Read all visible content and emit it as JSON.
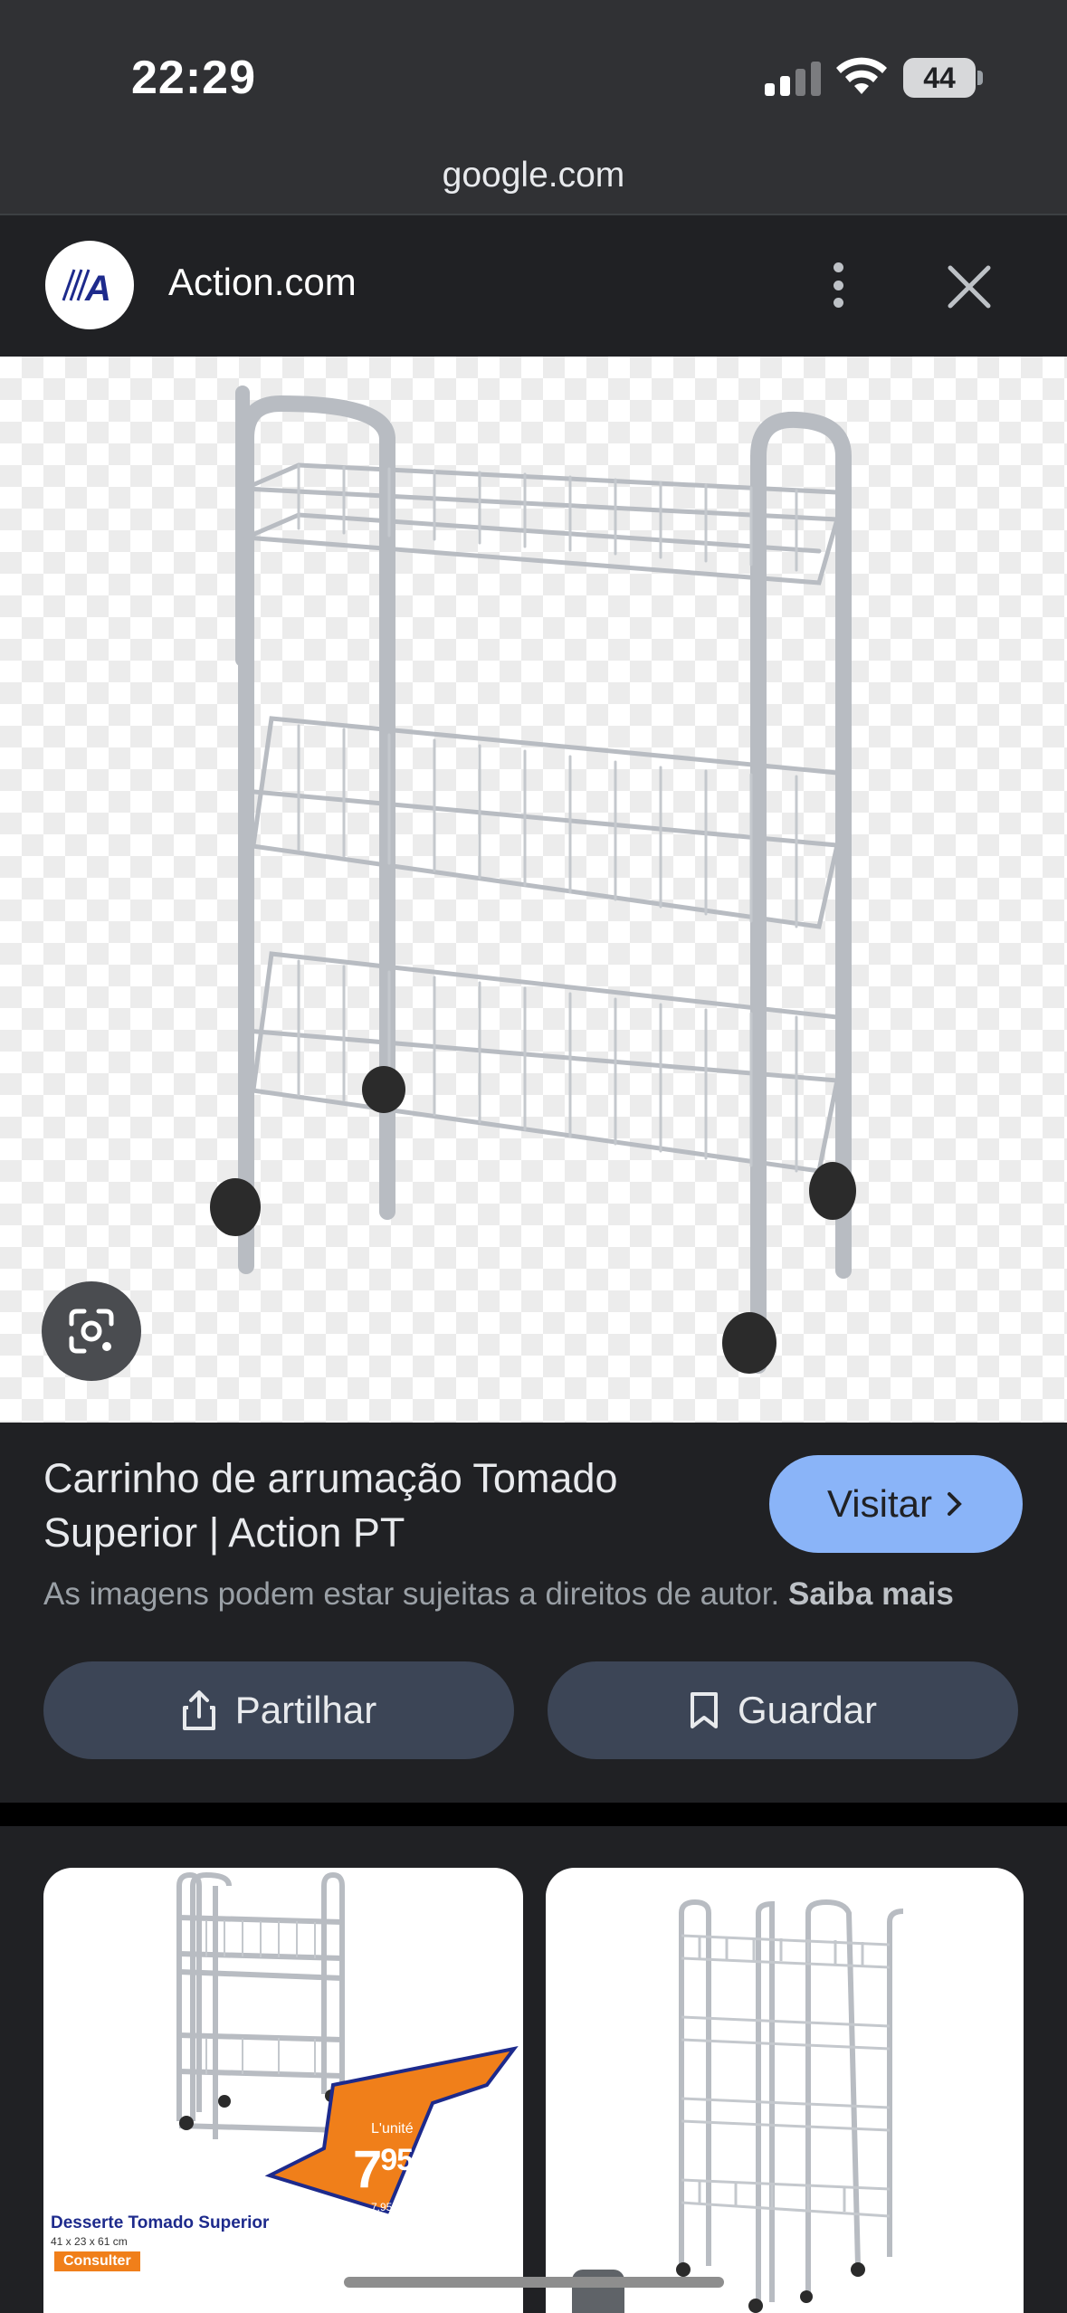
{
  "status_bar": {
    "time": "22:29",
    "battery": "44"
  },
  "browser": {
    "url": "google.com"
  },
  "site_header": {
    "site_name": "Action.com",
    "logo_letter": "A"
  },
  "result": {
    "title": "Carrinho de arrumação Tomado Superior | Action PT",
    "visit_label": "Visitar",
    "copyright_text": "As imagens podem estar sujeitas a direitos de autor.",
    "learn_more": "Saiba mais",
    "share_label": "Partilhar",
    "save_label": "Guardar"
  },
  "related": [
    {
      "title": "Desserte Tomado Superior",
      "dimensions": "41 x 23 x 61 cm",
      "cta": "Consulter",
      "unit_label": "L'unité",
      "price_int": "7",
      "price_dec": "95",
      "price_per": "7.95/pce"
    },
    {}
  ],
  "colors": {
    "background": "#202124",
    "topbar": "#303134",
    "visit_button": "#8ab4f8",
    "pill_button": "#3c4556",
    "price_arrow_fill": "#f07f1a",
    "price_arrow_stroke": "#1d2a8c"
  },
  "icons": [
    "signal-icon",
    "wifi-icon",
    "battery-icon",
    "more-vert-icon",
    "close-icon",
    "google-lens-icon",
    "chevron-right-icon",
    "share-icon",
    "bookmark-icon"
  ]
}
